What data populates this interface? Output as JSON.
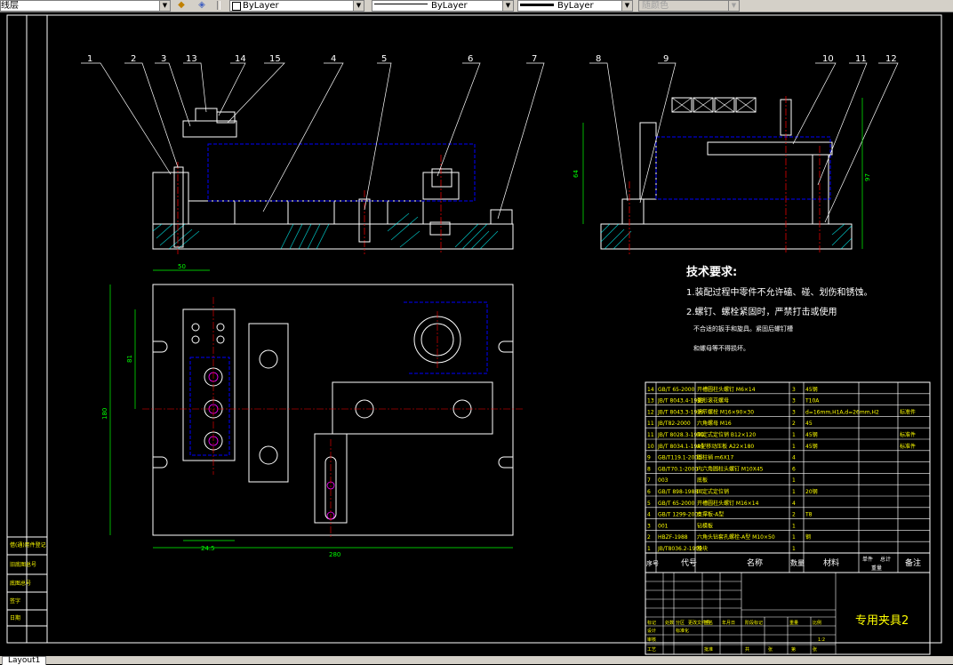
{
  "toolbar": {
    "layer_combo": "线层",
    "color_combo": "ByLayer",
    "linetype_combo": "ByLayer",
    "lineweight_combo": "ByLayer",
    "plotstyle_combo": "随颜色"
  },
  "drawing": {
    "balloons_front": [
      "1",
      "2",
      "3",
      "13",
      "14",
      "15",
      "4",
      "5",
      "6",
      "7"
    ],
    "balloons_side": [
      "8",
      "9",
      "10",
      "11",
      "12"
    ],
    "dims": {
      "d_top_width": "50",
      "d_bottom_width": "280",
      "d_left_height": "180",
      "d_inner_height": "81",
      "d_inner_width": "24.5",
      "d_side_height": "64",
      "d_side_height2": "97"
    },
    "tech_title": "技术要求:",
    "tech_lines": [
      "1.装配过程中零件不允许磕、碰、划伤和锈蚀。",
      "2.螺钉、螺栓紧固时，严禁打击或使用",
      "不合适的扳手和旋具。紧固后螺钉槽",
      "和螺母等不得损坏。"
    ]
  },
  "bom": {
    "rows": [
      {
        "no": "14",
        "code": "GB/T 65-2000",
        "name": "开槽圆柱头螺钉 M6×14",
        "qty": "3",
        "mat": "45钢",
        "note": ""
      },
      {
        "no": "13",
        "code": "JB/T 8043.4-1999",
        "name": "菱形滚花螺母",
        "qty": "3",
        "mat": "T10A",
        "note": ""
      },
      {
        "no": "12",
        "code": "JB/T 8043.3-1999",
        "name": "活节螺栓 M16×90×30",
        "qty": "3",
        "mat": "d=16mm,H1A,d=26mm,H2",
        "note": "标准件"
      },
      {
        "no": "11",
        "code": "JB/T82-2000",
        "name": "六角螺母 M16",
        "qty": "2",
        "mat": "45",
        "note": ""
      },
      {
        "no": "11",
        "code": "JB/T 8028.3-1999",
        "name": "固定式定位销 B12×120",
        "qty": "1",
        "mat": "45钢",
        "note": "标准件"
      },
      {
        "no": "10",
        "code": "JB/T 8034.1-1999",
        "name": "A型移动压板 A22×180",
        "qty": "1",
        "mat": "45钢",
        "note": "标准件"
      },
      {
        "no": "9",
        "code": "GB/T119.1-2000",
        "name": "圆柱销 m6X17",
        "qty": "4",
        "mat": "",
        "note": ""
      },
      {
        "no": "8",
        "code": "GB/T70.1-2000",
        "name": "内六角圆柱头螺钉 M10X45",
        "qty": "6",
        "mat": "",
        "note": ""
      },
      {
        "no": "7",
        "code": "003",
        "name": "底板",
        "qty": "1",
        "mat": "",
        "note": ""
      },
      {
        "no": "6",
        "code": "GB/T 898-1988",
        "name": "固定式定位销",
        "qty": "1",
        "mat": "20钢",
        "note": ""
      },
      {
        "no": "5",
        "code": "GB/T 65-2000",
        "name": "开槽圆柱头螺钉 M16×14",
        "qty": "4",
        "mat": "",
        "note": ""
      },
      {
        "no": "4",
        "code": "GB/T 1299-2000",
        "name": "支撑板-A型",
        "qty": "2",
        "mat": "T8",
        "note": ""
      },
      {
        "no": "3",
        "code": "001",
        "name": "钻模板",
        "qty": "1",
        "mat": "",
        "note": ""
      },
      {
        "no": "2",
        "code": "HBZF-1988",
        "name": "六角头钻套孔螺栓-A型 M10×50",
        "qty": "1",
        "mat": "钢",
        "note": ""
      },
      {
        "no": "1",
        "code": "JB/T8036.2-1999",
        "name": "垫块",
        "qty": "1",
        "mat": "",
        "note": ""
      }
    ],
    "header": {
      "no": "序号",
      "code": "代号",
      "name": "名称",
      "qty": "数量",
      "mat": "材料",
      "single": "单件",
      "total": "总计",
      "weight": "重量",
      "note": "备注"
    },
    "title": "专用夹具2",
    "small_labels": [
      "标记",
      "处数",
      "分区",
      "更改文件号",
      "签名",
      "年月日",
      "设计",
      "标准化",
      "审核",
      "工艺",
      "批准",
      "阶段标记",
      "重量",
      "比例",
      "共",
      "张",
      "第",
      "张",
      "1:2"
    ]
  },
  "left_block": [
    "借(通)用件登记",
    "旧底图总号",
    "底图总号",
    "签字",
    "日期"
  ],
  "layout_tab": "Layout1"
}
